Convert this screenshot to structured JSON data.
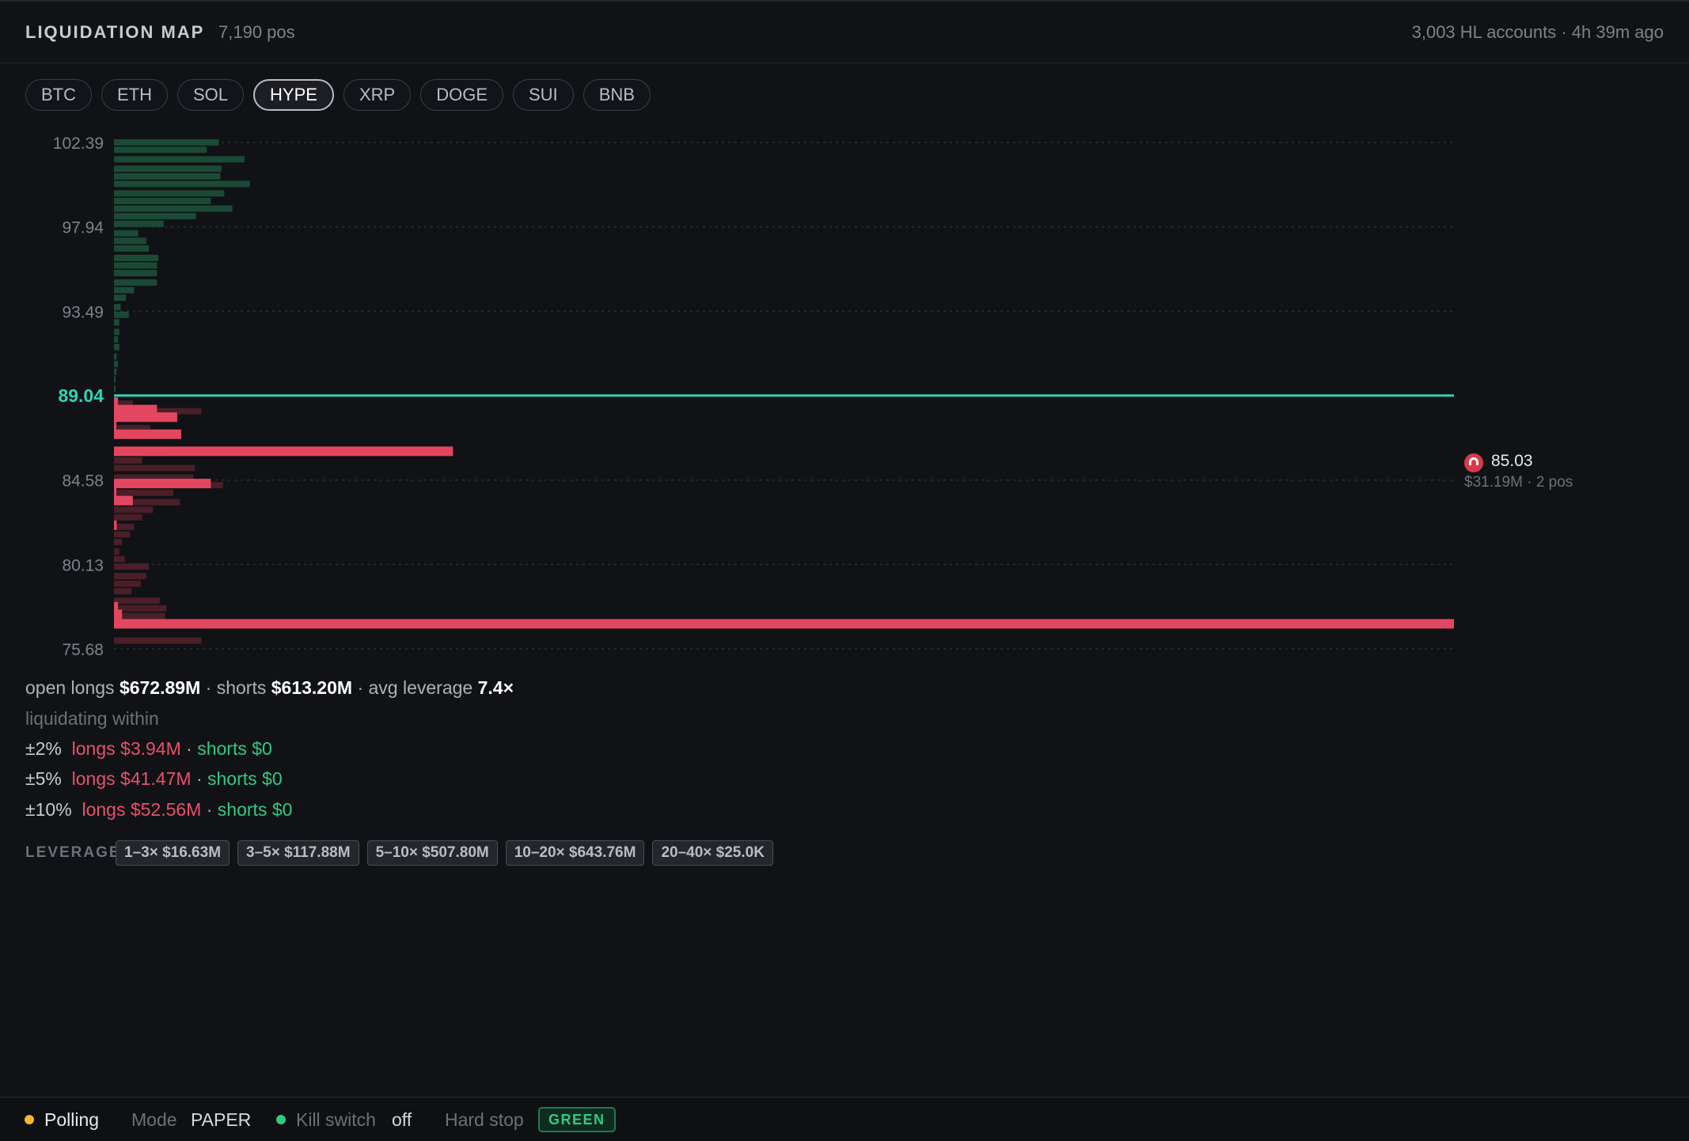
{
  "header": {
    "title": "LIQUIDATION MAP",
    "positions": "7,190 pos",
    "accounts": "3,003 HL accounts · 4h 39m ago"
  },
  "tabs": [
    "BTC",
    "ETH",
    "SOL",
    "HYPE",
    "XRP",
    "DOGE",
    "SUI",
    "BNB"
  ],
  "active_tab": "HYPE",
  "colors": {
    "short_bar": "#1a4a35",
    "long_bar": "#e3475f",
    "long_bar_dim": "#4a1f28",
    "current_price": "#2fd4b6",
    "gridline": "#2a2d33"
  },
  "chart_data": {
    "type": "bar",
    "orientation": "horizontal",
    "current_price": 89.04,
    "ylim": [
      75.68,
      102.39
    ],
    "y_ticks": [
      "102.39",
      "97.94",
      "93.49",
      "89.04",
      "84.58",
      "80.13",
      "75.68"
    ],
    "current_price_label": "89.04",
    "grid": true,
    "series": [
      {
        "side": "short",
        "prices": [
          102.39,
          102.0,
          101.5,
          101.0,
          100.6,
          100.2,
          99.7,
          99.3,
          98.9,
          98.5,
          98.1,
          97.6,
          97.2,
          96.8,
          96.3,
          95.9,
          95.5,
          95.0,
          94.6,
          94.2,
          93.7,
          93.3,
          92.9,
          92.4,
          92.0,
          91.6,
          91.1,
          90.7,
          90.3,
          89.9,
          89.4
        ],
        "values_musd": [
          7.8,
          6.9,
          9.7,
          8.0,
          7.9,
          10.1,
          8.2,
          7.2,
          8.8,
          6.1,
          3.7,
          1.8,
          2.4,
          2.6,
          3.3,
          3.2,
          3.2,
          3.2,
          1.5,
          0.9,
          0.5,
          1.1,
          0.4,
          0.4,
          0.3,
          0.4,
          0.2,
          0.3,
          0.2,
          0.1,
          0.1
        ]
      },
      {
        "side": "long",
        "prices": [
          88.7,
          88.3,
          87.9,
          87.4,
          87.0,
          86.6,
          86.1,
          85.7,
          85.3,
          84.8,
          84.4,
          84.0,
          83.5,
          83.1,
          82.7,
          82.2,
          81.8,
          81.4,
          80.9,
          80.5,
          80.1,
          79.6,
          79.2,
          78.8,
          78.3,
          77.9,
          77.5,
          77.0,
          76.6,
          76.2,
          75.8
        ],
        "values_musd": [
          0.3,
          3.2,
          4.7,
          0.1,
          5.0,
          0.0,
          25.2,
          0.0,
          0.0,
          0.0,
          7.2,
          0.1,
          1.4,
          0.0,
          0.0,
          0.2,
          0.0,
          0.0,
          0.0,
          0.0,
          0.0,
          0.0,
          0.0,
          0.0,
          0.0,
          0.3,
          0.6,
          99.6,
          0.0,
          0.0,
          0.0
        ],
        "context_musd": [
          1.4,
          6.5,
          4.6,
          2.7,
          2.4,
          0.0,
          4.1,
          2.1,
          6.0,
          5.9,
          8.1,
          4.4,
          4.9,
          2.9,
          2.1,
          1.5,
          1.2,
          0.6,
          0.4,
          0.8,
          2.6,
          2.4,
          2.0,
          1.3,
          3.4,
          3.9,
          3.8,
          6.5,
          0.0,
          6.5,
          0.0
        ]
      }
    ]
  },
  "magnet": {
    "price": "85.03",
    "detail": "$31.19M · 2 pos"
  },
  "stats": {
    "open_longs_label": "open longs",
    "open_longs": "$672.89M",
    "shorts_label": "shorts",
    "shorts": "$613.20M",
    "avg_leverage_label": "avg leverage",
    "avg_leverage": "7.4×"
  },
  "liquidating": {
    "label": "liquidating within",
    "rows": [
      {
        "range": "±2%",
        "longs": "longs $3.94M",
        "shorts": "shorts $0"
      },
      {
        "range": "±5%",
        "longs": "longs $41.47M",
        "shorts": "shorts $0"
      },
      {
        "range": "±10%",
        "longs": "longs $52.56M",
        "shorts": "shorts $0"
      }
    ]
  },
  "leverage": {
    "label": "LEVERAGE",
    "chips": [
      "1–3× $16.63M",
      "3–5× $117.88M",
      "5–10× $507.80M",
      "10–20× $643.76M",
      "20–40× $25.0K"
    ]
  },
  "footer": {
    "status": "Polling",
    "mode_label": "Mode",
    "mode_value": "PAPER",
    "kill_label": "Kill switch",
    "kill_value": "off",
    "hard_stop_label": "Hard stop",
    "hard_stop_value": "GREEN",
    "status_color": "#f5b82e",
    "kill_color": "#2ecb83"
  }
}
